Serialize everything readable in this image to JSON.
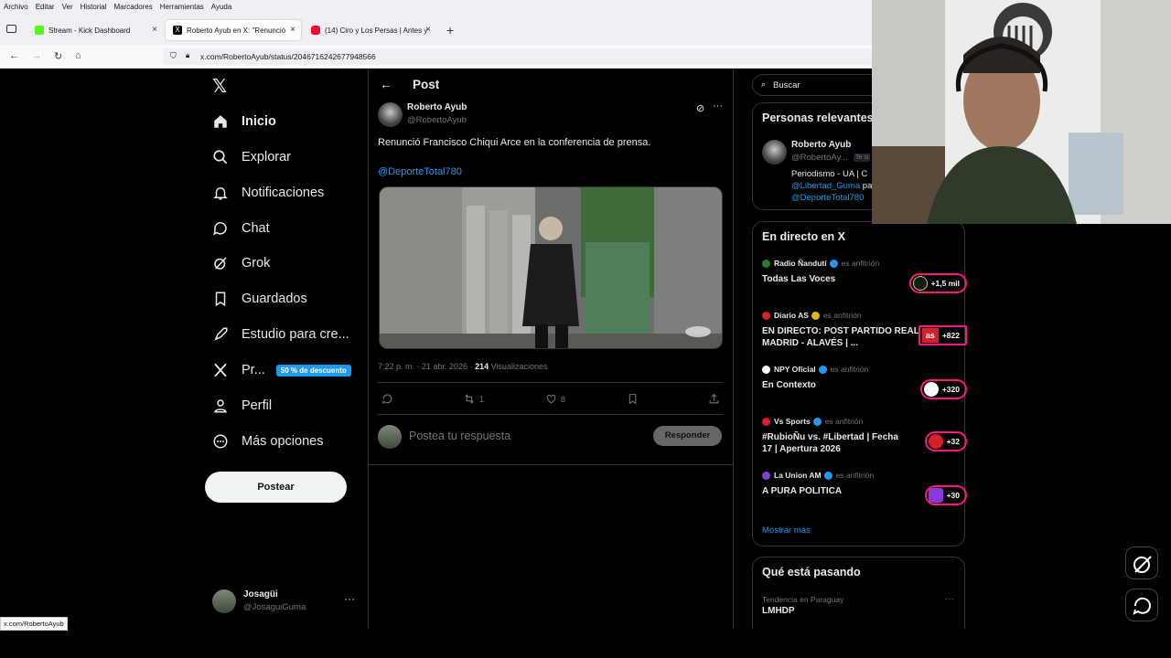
{
  "browser": {
    "menu": [
      "Archivo",
      "Editar",
      "Ver",
      "Historial",
      "Marcadores",
      "Herramientas",
      "Ayuda"
    ],
    "tabs": [
      {
        "title": "Stream - Kick Dashboard",
        "color": "#53fc18"
      },
      {
        "title": "Roberto Ayub en X: \"Renunció |",
        "color": "#000000"
      },
      {
        "title": "(14) Ciro y Los Persas | Antes y |",
        "color": "#ff0033"
      }
    ],
    "url": "x.com/RobertoAyub/status/2046716242677948566",
    "status_url": "x.com/RobertoAyub"
  },
  "nav": {
    "items": [
      "Inicio",
      "Explorar",
      "Notificaciones",
      "Chat",
      "Grok",
      "Guardados",
      "Estudio para cre...",
      "Pr...",
      "Perfil",
      "Más opciones"
    ],
    "premium_badge": "50 % de descuento",
    "post_button": "Postear",
    "account_name": "Josagüi",
    "account_handle": "@JosaguiGuma"
  },
  "post": {
    "header": "Post",
    "author_name": "Roberto Ayub",
    "author_handle": "@RobertoAyub",
    "text": "Renunció Francisco Chiqui Arce en la conferencia de prensa.",
    "mention": "@DeporteTotal780",
    "time": "7:22 p. m. · 21 abr. 2026 · ",
    "views_count": "214",
    "views_label": " Visualizaciones",
    "retweets": "1",
    "likes": "8",
    "reply_placeholder": "Postea tu respuesta",
    "reply_button": "Responder"
  },
  "sidebar": {
    "search_placeholder": "Buscar",
    "relevant_title": "Personas relevantes",
    "relevant_name": "Roberto Ayub",
    "relevant_handle": "@RobertoAy...",
    "relevant_badge": "Te si",
    "relevant_bio1": "Periodismo - UA | C",
    "relevant_bio2": "@Libertad_Guma",
    "relevant_bio2b": " pa",
    "relevant_bio3": "@DeporteTotal780",
    "live_title": "En directo en X",
    "host_suffix": "es anfitrión",
    "live": [
      {
        "host": "Radio Ñandutí",
        "title": "Todas Las Voces",
        "count": "+1,5 mil",
        "color": "#1a1a1a",
        "badge": "#1d9bf0"
      },
      {
        "host": "Diario AS",
        "title": "EN DIRECTO: POST PARTIDO REAL MADRID - ALAVÉS | ...",
        "count": "+822",
        "color": "#d81e2b",
        "badge": "#e2b719"
      },
      {
        "host": "NPY Oficial",
        "title": "En Contexto",
        "count": "+320",
        "color": "#ffffff",
        "badge": "#1d9bf0"
      },
      {
        "host": "Vs Sports",
        "title": "#RubioÑu vs. #Libertad | Fecha 17 | Apertura 2026",
        "count": "+32",
        "color": "#d81e2b",
        "badge": "#1d9bf0"
      },
      {
        "host": "La Union AM",
        "title": "A PURA POLITICA",
        "count": "+30",
        "color": "#8a3ad8",
        "badge": "#1d9bf0"
      }
    ],
    "show_more": "Mostrar más",
    "trends_title": "Qué está pasando",
    "trend_context": "Tendencia en Paraguay",
    "trend_name": "LMHDP"
  },
  "colors": {
    "accent": "#1d9bf0",
    "live": "#f91880"
  }
}
